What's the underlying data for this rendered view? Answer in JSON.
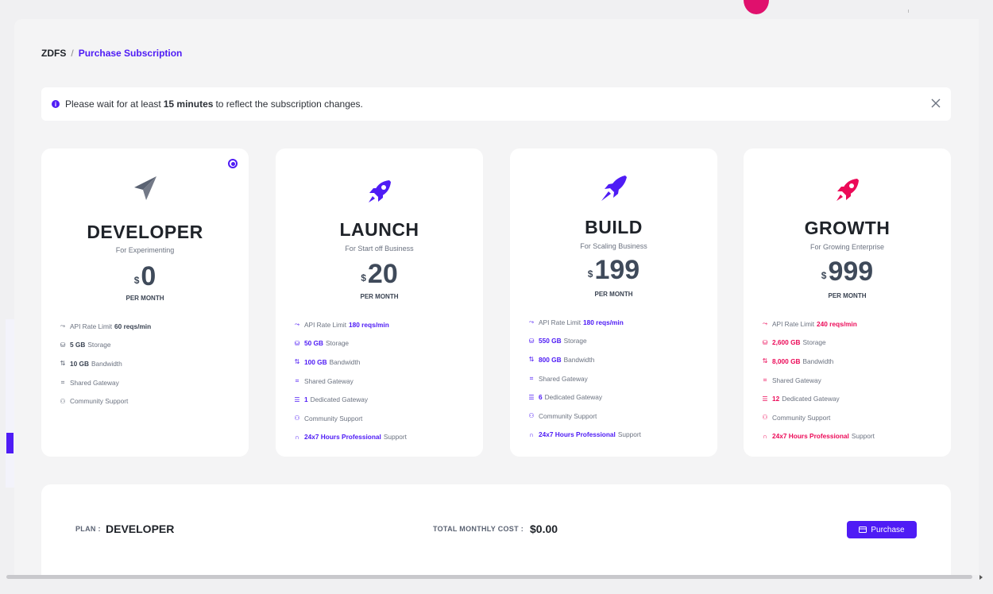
{
  "breadcrumb": {
    "root": "ZDFS",
    "separator": "/",
    "current": "Purchase Subscription"
  },
  "notice": {
    "prefix": "Please wait for at least",
    "bold": "15 minutes",
    "suffix": "to reflect the subscription changes.",
    "info_icon": "i"
  },
  "plans": [
    {
      "name": "DEVELOPER",
      "tagline": "For Experimenting",
      "currency": "$",
      "price": "0",
      "period": "PER MONTH",
      "icon": "paper-plane-icon",
      "color": "#5a6272",
      "selected": true,
      "features": [
        {
          "icon": "rate-icon",
          "pre": "API Rate Limit",
          "hl": "60 reqs/min",
          "post": ""
        },
        {
          "icon": "storage-icon",
          "pre": "",
          "hl": "5 GB",
          "post": "Storage"
        },
        {
          "icon": "bandwidth-icon",
          "pre": "",
          "hl": "10 GB",
          "post": "Bandwidth"
        },
        {
          "icon": "gateway-icon",
          "pre": "",
          "hl": "",
          "post": "Shared Gateway"
        },
        {
          "icon": "community-icon",
          "pre": "",
          "hl": "",
          "post": "Community Support"
        }
      ]
    },
    {
      "name": "LAUNCH",
      "tagline": "For Start off Business",
      "currency": "$",
      "price": "20",
      "period": "PER MONTH",
      "icon": "rocket-icon",
      "color": "#4f1cf5",
      "selected": false,
      "features": [
        {
          "icon": "rate-icon",
          "pre": "API Rate Limit",
          "hl": "180 reqs/min",
          "post": ""
        },
        {
          "icon": "storage-icon",
          "pre": "",
          "hl": "50 GB",
          "post": "Storage"
        },
        {
          "icon": "bandwidth-icon",
          "pre": "",
          "hl": "100 GB",
          "post": "Bandwidth"
        },
        {
          "icon": "gateway-icon",
          "pre": "",
          "hl": "",
          "post": "Shared Gateway"
        },
        {
          "icon": "dedicated-gateway-icon",
          "pre": "",
          "hl": "1",
          "post": "Dedicated Gateway"
        },
        {
          "icon": "community-icon",
          "pre": "",
          "hl": "",
          "post": "Community Support"
        },
        {
          "icon": "headset-icon",
          "pre": "",
          "hl": "24x7 Hours Professional",
          "post": "Support"
        }
      ]
    },
    {
      "name": "BUILD",
      "tagline": "For Scaling Business",
      "currency": "$",
      "price": "199",
      "period": "PER MONTH",
      "icon": "rocket-launch-icon",
      "color": "#4f1cf5",
      "selected": false,
      "features": [
        {
          "icon": "rate-icon",
          "pre": "API Rate Limit",
          "hl": "180 reqs/min",
          "post": ""
        },
        {
          "icon": "storage-icon",
          "pre": "",
          "hl": "550 GB",
          "post": "Storage"
        },
        {
          "icon": "bandwidth-icon",
          "pre": "",
          "hl": "800 GB",
          "post": "Bandwidth"
        },
        {
          "icon": "gateway-icon",
          "pre": "",
          "hl": "",
          "post": "Shared Gateway"
        },
        {
          "icon": "dedicated-gateway-icon",
          "pre": "",
          "hl": "6",
          "post": "Dedicated Gateway"
        },
        {
          "icon": "community-icon",
          "pre": "",
          "hl": "",
          "post": "Community Support"
        },
        {
          "icon": "headset-icon",
          "pre": "",
          "hl": "24x7 Hours Professional",
          "post": "Support"
        }
      ]
    },
    {
      "name": "GROWTH",
      "tagline": "For Growing Enterprise",
      "currency": "$",
      "price": "999",
      "period": "PER MONTH",
      "icon": "rocket-icon",
      "color": "#ec0a58",
      "selected": false,
      "features": [
        {
          "icon": "rate-icon",
          "pre": "API Rate Limit",
          "hl": "240 reqs/min",
          "post": ""
        },
        {
          "icon": "storage-icon",
          "pre": "",
          "hl": "2,600 GB",
          "post": "Storage"
        },
        {
          "icon": "bandwidth-icon",
          "pre": "",
          "hl": "8,000 GB",
          "post": "Bandwidth"
        },
        {
          "icon": "gateway-icon",
          "pre": "",
          "hl": "",
          "post": "Shared Gateway"
        },
        {
          "icon": "dedicated-gateway-icon",
          "pre": "",
          "hl": "12",
          "post": "Dedicated Gateway"
        },
        {
          "icon": "community-icon",
          "pre": "",
          "hl": "",
          "post": "Community Support"
        },
        {
          "icon": "headset-icon",
          "pre": "",
          "hl": "24x7 Hours Professional",
          "post": "Support"
        }
      ]
    }
  ],
  "summary": {
    "plan_label": "PLAN :",
    "plan_value": "DEVELOPER",
    "cost_label": "TOTAL MONTHLY COST :",
    "cost_value": "$0.00",
    "purchase_label": "Purchase"
  },
  "colors": {
    "accent": "#4f1cf5",
    "growth": "#ec0a58",
    "developer": "#5a6272"
  }
}
